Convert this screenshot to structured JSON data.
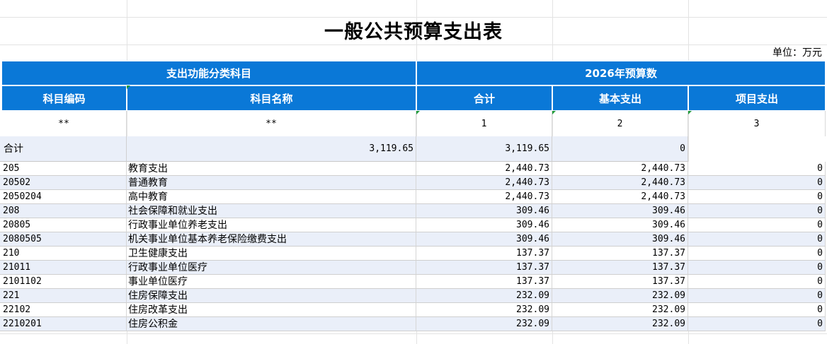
{
  "title": "一般公共预算支出表",
  "unit": "单位：万元",
  "header": {
    "group_left": "支出功能分类科目",
    "group_right": "2026年预算数",
    "code": "科目编码",
    "name": "科目名称",
    "total": "合计",
    "basic": "基本支出",
    "project": "项目支出"
  },
  "index_row": {
    "code": "**",
    "name": "**",
    "total": "1",
    "basic": "2",
    "project": "3"
  },
  "total_row": {
    "label": "合计",
    "c1": "3,119.65",
    "c2": "3,119.65",
    "c3": "0"
  },
  "rows": [
    {
      "code": "205",
      "name": "教育支出",
      "total": "2,440.73",
      "basic": "2,440.73",
      "project": "0"
    },
    {
      "code": "20502",
      "name": "普通教育",
      "total": "2,440.73",
      "basic": "2,440.73",
      "project": "0"
    },
    {
      "code": "2050204",
      "name": "高中教育",
      "total": "2,440.73",
      "basic": "2,440.73",
      "project": "0"
    },
    {
      "code": "208",
      "name": "社会保障和就业支出",
      "total": "309.46",
      "basic": "309.46",
      "project": "0"
    },
    {
      "code": "20805",
      "name": "行政事业单位养老支出",
      "total": "309.46",
      "basic": "309.46",
      "project": "0"
    },
    {
      "code": "2080505",
      "name": "机关事业单位基本养老保险缴费支出",
      "total": "309.46",
      "basic": "309.46",
      "project": "0"
    },
    {
      "code": "210",
      "name": "卫生健康支出",
      "total": "137.37",
      "basic": "137.37",
      "project": "0"
    },
    {
      "code": "21011",
      "name": "行政事业单位医疗",
      "total": "137.37",
      "basic": "137.37",
      "project": "0"
    },
    {
      "code": "2101102",
      "name": "事业单位医疗",
      "total": "137.37",
      "basic": "137.37",
      "project": "0"
    },
    {
      "code": "221",
      "name": "住房保障支出",
      "total": "232.09",
      "basic": "232.09",
      "project": "0"
    },
    {
      "code": "22102",
      "name": "住房改革支出",
      "total": "232.09",
      "basic": "232.09",
      "project": "0"
    },
    {
      "code": "2210201",
      "name": "住房公积金",
      "total": "232.09",
      "basic": "232.09",
      "project": "0"
    }
  ],
  "colors": {
    "header_bg": "#0a78d7",
    "row_alt_bg": "#eaeff9",
    "comment_marker": "#1f9a3a"
  }
}
